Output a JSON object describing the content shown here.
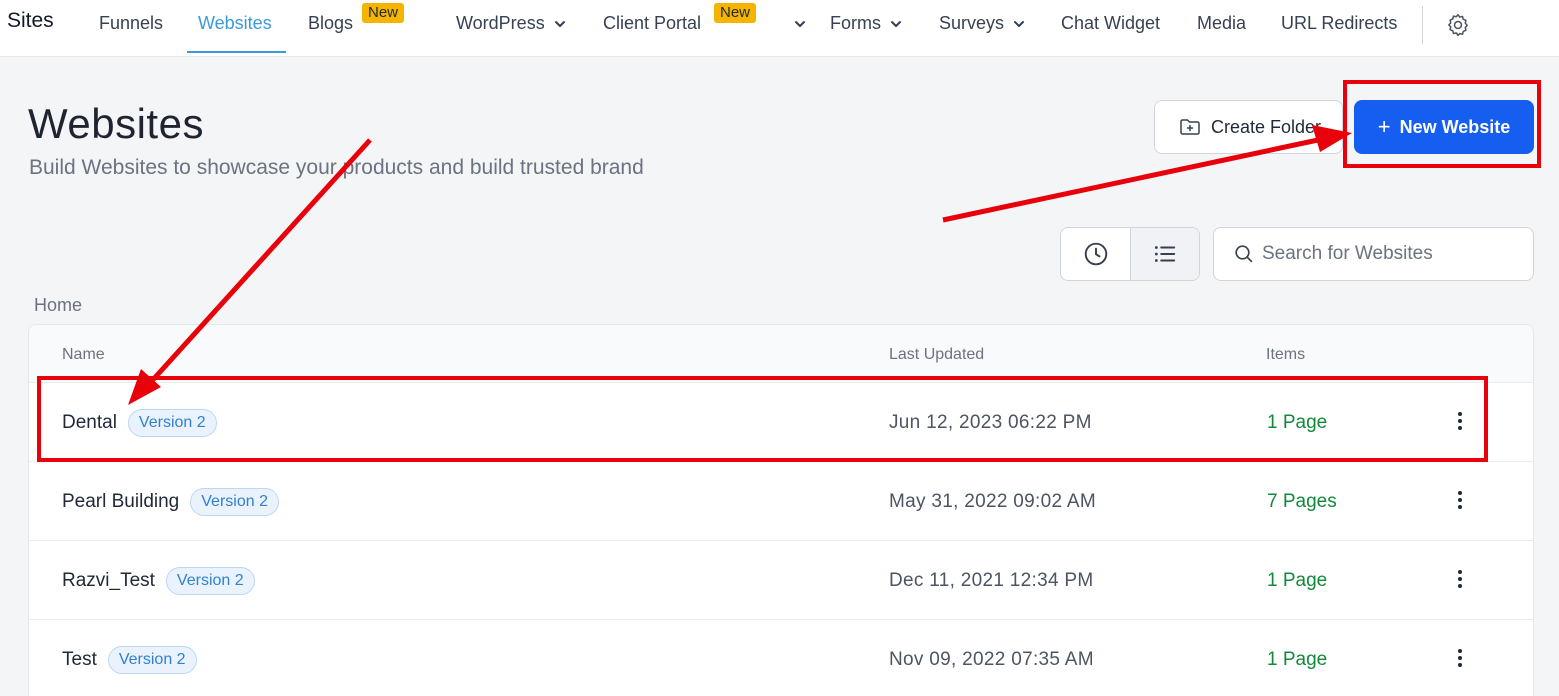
{
  "topnav": {
    "brand": "Sites",
    "items": [
      {
        "label": "Funnels"
      },
      {
        "label": "Websites"
      },
      {
        "label": "Blogs",
        "badge": "New"
      },
      {
        "label": "WordPress"
      },
      {
        "label": "Client Portal",
        "badge": "New"
      },
      {
        "label": "Forms"
      },
      {
        "label": "Surveys"
      },
      {
        "label": "Chat Widget"
      },
      {
        "label": "Media"
      },
      {
        "label": "URL Redirects"
      }
    ],
    "active_item": "Websites",
    "accent_color": "#3b9ad9"
  },
  "header": {
    "title": "Websites",
    "subtitle": "Build Websites to showcase your products and build trusted brand",
    "create_folder_label": "Create Folder",
    "new_website_label": "New Website",
    "primary_color": "#155eef"
  },
  "toolbar": {
    "search_placeholder": "Search for Websites",
    "active_view": "list"
  },
  "breadcrumb": "Home",
  "table": {
    "columns": [
      "Name",
      "Last Updated",
      "Items"
    ],
    "rows": [
      {
        "name": "Dental",
        "version": "Version 2",
        "updated": "Jun 12, 2023 06:22 PM",
        "items": "1 Page"
      },
      {
        "name": "Pearl Building",
        "version": "Version 2",
        "updated": "May 31, 2022 09:02 AM",
        "items": "7 Pages"
      },
      {
        "name": "Razvi_Test",
        "version": "Version 2",
        "updated": "Dec 11, 2021 12:34 PM",
        "items": "1 Page"
      },
      {
        "name": "Test",
        "version": "Version 2",
        "updated": "Nov 09, 2022 07:35 AM",
        "items": "1 Page"
      }
    ]
  },
  "annotation_color": "#e8000b"
}
